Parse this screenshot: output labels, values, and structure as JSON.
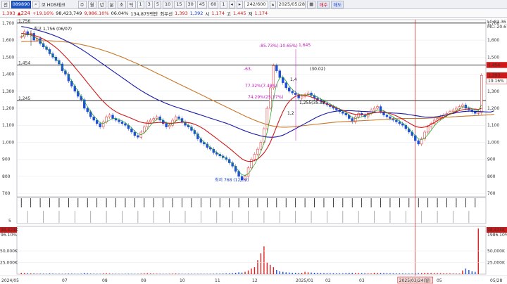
{
  "toolbar": {
    "menu_label": "전",
    "stock_code": "089890",
    "stock_name": "코 HDS테크",
    "periods": [
      "주",
      "월",
      "년",
      "분",
      "초",
      "틱"
    ],
    "intervals": [
      "1",
      "3",
      "5",
      "10",
      "15",
      "30",
      "45",
      "60",
      "1"
    ],
    "count": "242/600",
    "date": "2025/05/28",
    "buttons": [
      "매수",
      "매도"
    ]
  },
  "quote": {
    "price": "1,393",
    "change": "224",
    "change_pct": "+19.16%",
    "volume": "98,423,749",
    "volume_pct": "9,986.10%",
    "turnover_rate": "06.04%",
    "amount": "134,875백만",
    "best_label": "최우선",
    "bid": "1,393",
    "ask": "1,392",
    "open_label": "시",
    "open": "1,174",
    "high_label": "고",
    "high": "1,445",
    "low_label": "저",
    "low": "1,174"
  },
  "colors": {
    "up": "#e02020",
    "down": "#1f4fd8",
    "ma5": "#18a018",
    "ma20": "#d01818",
    "ma60": "#1a1aa8",
    "ma120": "#c87828"
  },
  "price_axis": {
    "ticks": [
      "1,700",
      "1,600",
      "1,500",
      "1,400",
      "1,300",
      "1,200",
      "1,100",
      "1,000",
      "900",
      "800",
      "700"
    ],
    "range": [
      680,
      1720
    ]
  },
  "levels": [
    {
      "label": "1,756",
      "value": 1700,
      "color": "#111"
    },
    {
      "label": "1,454",
      "value": 1454,
      "color": "#111"
    },
    {
      "label": "1,245",
      "value": 1245,
      "color": "#111"
    }
  ],
  "right_flags": [
    {
      "label": "1,454",
      "bg": "#d01818",
      "value": 1454
    },
    {
      "label": "1,393",
      "bg": "#d01818",
      "value": 1393
    },
    {
      "label": "19.16%",
      "bg": "#ffffff",
      "value": 1360
    }
  ],
  "legend_right": {
    "lc": "LC:81.36",
    "mc": "MC:-20.67"
  },
  "annotations": {
    "high_label": "최고 1,756 (06/07)",
    "low_label": "최저 768 (12/09)",
    "pct1": "-85.73%(-10.65%)",
    "peak_value": "1,645",
    "pct2": "-63,",
    "peak_row": "1,4",
    "pct_30": "(30.02)",
    "pct3": "77.32%(7.48%)",
    "pct4": "74.29%(25.37%)",
    "low_tag": "1,255(35.32",
    "mid_label": "1,2"
  },
  "signal_axis": {
    "tick": "5"
  },
  "volume_axis": {
    "ticks": [
      "50,000K",
      "25,000K"
    ],
    "left_top": "98,424K",
    "left_sub": "96.10%",
    "right_top": "98,424K",
    "right_sub": "1986.10%"
  },
  "x_axis": {
    "labels": [
      "2024/05",
      "07",
      "08",
      "09",
      "10",
      "11",
      "12",
      "2025/01",
      "02",
      "03",
      "04",
      "05",
      "05/28"
    ],
    "cursor_label": "2025/03/24(월)"
  },
  "chart_data": {
    "type": "candlestick",
    "ylim": [
      680,
      1720
    ],
    "levels": [
      1700,
      1454,
      1245
    ],
    "closes": [
      1620,
      1650,
      1630,
      1640,
      1600,
      1610,
      1580,
      1560,
      1545,
      1520,
      1500,
      1480,
      1460,
      1420,
      1400,
      1360,
      1330,
      1300,
      1270,
      1250,
      1200,
      1180,
      1150,
      1130,
      1110,
      1090,
      1120,
      1150,
      1160,
      1140,
      1130,
      1120,
      1110,
      1100,
      1080,
      1060,
      1040,
      1030,
      1060,
      1090,
      1120,
      1130,
      1140,
      1150,
      1130,
      1110,
      1090,
      1100,
      1130,
      1150,
      1140,
      1120,
      1100,
      1090,
      1070,
      1050,
      1020,
      1000,
      990,
      970,
      960,
      940,
      930,
      920,
      910,
      900,
      880,
      860,
      830,
      800,
      780,
      800,
      850,
      900,
      930,
      960,
      1000,
      1080,
      1200,
      1320,
      1450,
      1420,
      1380,
      1350,
      1320,
      1300,
      1290,
      1280,
      1260,
      1270,
      1280,
      1290,
      1275,
      1260,
      1250,
      1240,
      1230,
      1220,
      1210,
      1200,
      1190,
      1180,
      1170,
      1160,
      1140,
      1120,
      1150,
      1170,
      1160,
      1150,
      1170,
      1190,
      1200,
      1210,
      1180,
      1160,
      1150,
      1140,
      1130,
      1120,
      1110,
      1100,
      1080,
      1060,
      1040,
      1010,
      990,
      1020,
      1060,
      1090,
      1110,
      1130,
      1140,
      1150,
      1160,
      1170,
      1180,
      1190,
      1200,
      1210,
      1220,
      1200,
      1190,
      1180,
      1170,
      1175,
      1393
    ],
    "ma5": [
      1620,
      1630,
      1635,
      1630,
      1620,
      1610,
      1595,
      1575,
      1555,
      1530,
      1510,
      1490,
      1470,
      1440,
      1420,
      1390,
      1360,
      1330,
      1300,
      1270,
      1240,
      1210,
      1180,
      1155,
      1135,
      1115,
      1110,
      1120,
      1130,
      1140,
      1140,
      1135,
      1125,
      1115,
      1100,
      1085,
      1065,
      1050,
      1045,
      1055,
      1075,
      1100,
      1120,
      1135,
      1140,
      1130,
      1115,
      1105,
      1110,
      1125,
      1135,
      1130,
      1115,
      1100,
      1085,
      1065,
      1045,
      1020,
      1000,
      985,
      970,
      955,
      940,
      928,
      915,
      903,
      890,
      875,
      855,
      830,
      810,
      805,
      815,
      840,
      870,
      905,
      945,
      995,
      1060,
      1150,
      1260,
      1340,
      1380,
      1385,
      1360,
      1330,
      1310,
      1295,
      1282,
      1276,
      1275,
      1280,
      1282,
      1275,
      1265,
      1255,
      1245,
      1235,
      1225,
      1215,
      1205,
      1195,
      1185,
      1175,
      1160,
      1145,
      1140,
      1145,
      1150,
      1155,
      1160,
      1170,
      1180,
      1190,
      1190,
      1185,
      1175,
      1160,
      1148,
      1137,
      1125,
      1113,
      1098,
      1080,
      1060,
      1040,
      1020,
      1015,
      1025,
      1045,
      1070,
      1095,
      1115,
      1130,
      1143,
      1155,
      1165,
      1175,
      1185,
      1195,
      1205,
      1210,
      1205,
      1198,
      1190,
      1183,
      1220
    ],
    "ma20": [
      1640,
      1638,
      1635,
      1632,
      1628,
      1622,
      1615,
      1606,
      1596,
      1584,
      1570,
      1556,
      1540,
      1522,
      1503,
      1483,
      1462,
      1440,
      1418,
      1396,
      1373,
      1350,
      1327,
      1304,
      1282,
      1260,
      1240,
      1222,
      1206,
      1192,
      1180,
      1170,
      1162,
      1155,
      1148,
      1140,
      1132,
      1124,
      1118,
      1114,
      1112,
      1112,
      1114,
      1116,
      1117,
      1116,
      1114,
      1112,
      1112,
      1114,
      1116,
      1118,
      1118,
      1116,
      1112,
      1106,
      1098,
      1088,
      1077,
      1064,
      1050,
      1036,
      1022,
      1008,
      994,
      980,
      965,
      950,
      934,
      918,
      903,
      893,
      888,
      888,
      893,
      903,
      918,
      938,
      965,
      1000,
      1045,
      1092,
      1138,
      1180,
      1215,
      1240,
      1258,
      1270,
      1276,
      1278,
      1276,
      1272,
      1266,
      1258,
      1250,
      1242,
      1234,
      1226,
      1218,
      1210,
      1202,
      1195,
      1188,
      1181,
      1174,
      1168,
      1164,
      1162,
      1162,
      1163,
      1166,
      1170,
      1174,
      1177,
      1178,
      1177,
      1174,
      1169,
      1163,
      1155,
      1146,
      1136,
      1125,
      1114,
      1103,
      1094,
      1089,
      1087,
      1090,
      1096,
      1105,
      1116,
      1127,
      1138,
      1148,
      1158,
      1166,
      1173,
      1180,
      1186,
      1191,
      1194,
      1196,
      1196,
      1195,
      1193,
      1200
    ],
    "ma60": [
      1680,
      1677,
      1673,
      1669,
      1664,
      1659,
      1654,
      1649,
      1643,
      1637,
      1630,
      1623,
      1615,
      1607,
      1598,
      1589,
      1579,
      1569,
      1558,
      1547,
      1535,
      1523,
      1510,
      1497,
      1484,
      1471,
      1458,
      1445,
      1432,
      1419,
      1406,
      1393,
      1380,
      1367,
      1354,
      1341,
      1328,
      1316,
      1304,
      1293,
      1282,
      1272,
      1262,
      1253,
      1244,
      1236,
      1228,
      1221,
      1214,
      1208,
      1202,
      1196,
      1190,
      1184,
      1178,
      1172,
      1166,
      1160,
      1154,
      1148,
      1142,
      1136,
      1130,
      1124,
      1118,
      1112,
      1105,
      1098,
      1090,
      1082,
      1074,
      1067,
      1060,
      1054,
      1048,
      1043,
      1038,
      1034,
      1031,
      1030,
      1030,
      1032,
      1036,
      1042,
      1050,
      1060,
      1070,
      1080,
      1090,
      1100,
      1110,
      1120,
      1130,
      1140,
      1150,
      1158,
      1165,
      1171,
      1176,
      1180,
      1183,
      1185,
      1186,
      1186,
      1186,
      1185,
      1184,
      1183,
      1182,
      1181,
      1180,
      1179,
      1178,
      1177,
      1176,
      1175,
      1174,
      1173,
      1172,
      1171,
      1170,
      1168,
      1166,
      1163,
      1160,
      1157,
      1154,
      1151,
      1149,
      1148,
      1148,
      1149,
      1151,
      1154,
      1158,
      1162,
      1166,
      1170,
      1174,
      1177,
      1180,
      1182,
      1183,
      1183,
      1182,
      1181,
      1180,
      1179,
      1178,
      1178,
      1185
    ],
    "ma120": [
      1590,
      1591,
      1592,
      1593,
      1594,
      1595,
      1596,
      1596,
      1596,
      1596,
      1595,
      1594,
      1593,
      1591,
      1589,
      1587,
      1584,
      1581,
      1578,
      1574,
      1570,
      1566,
      1561,
      1556,
      1551,
      1546,
      1540,
      1534,
      1528,
      1521,
      1514,
      1507,
      1500,
      1492,
      1484,
      1476,
      1468,
      1460,
      1451,
      1442,
      1433,
      1424,
      1415,
      1406,
      1397,
      1388,
      1379,
      1370,
      1361,
      1352,
      1343,
      1334,
      1325,
      1316,
      1307,
      1298,
      1289,
      1280,
      1271,
      1262,
      1253,
      1244,
      1235,
      1226,
      1217,
      1208,
      1199,
      1190,
      1181,
      1172,
      1163,
      1154,
      1146,
      1138,
      1130,
      1123,
      1116,
      1110,
      1104,
      1099,
      1095,
      1092,
      1090,
      1089,
      1089,
      1090,
      1091,
      1093,
      1095,
      1097,
      1099,
      1101,
      1103,
      1105,
      1107,
      1109,
      1111,
      1113,
      1115,
      1117,
      1119,
      1120,
      1121,
      1122,
      1123,
      1124,
      1125,
      1126,
      1127,
      1128,
      1129,
      1130,
      1131,
      1132,
      1133,
      1134,
      1135,
      1136,
      1137,
      1138,
      1139,
      1140,
      1140,
      1140,
      1140,
      1140,
      1140,
      1140,
      1141,
      1142,
      1143,
      1144,
      1145,
      1146,
      1147,
      1148,
      1149,
      1150,
      1151,
      1152,
      1153,
      1154,
      1155,
      1156,
      1157,
      1158,
      1159,
      1160,
      1161,
      1162,
      1165
    ],
    "volume_k": [
      3000,
      2500,
      2000,
      1800,
      1500,
      1300,
      1200,
      1100,
      1000,
      1500,
      1200,
      900,
      1000,
      800,
      1100,
      1300,
      1200,
      900,
      800,
      1000,
      2500,
      1800,
      1200,
      1000,
      900,
      800,
      1600,
      2000,
      1300,
      1000,
      900,
      800,
      700,
      900,
      1000,
      800,
      700,
      800,
      1200,
      1800,
      2000,
      1500,
      1200,
      1000,
      900,
      800,
      700,
      900,
      1200,
      1400,
      1000,
      800,
      700,
      900,
      800,
      700,
      800,
      900,
      800,
      700,
      800,
      900,
      1000,
      1200,
      1400,
      1600,
      1800,
      2200,
      3000,
      4000,
      3500,
      5000,
      8000,
      12000,
      15000,
      30000,
      45000,
      60000,
      25000,
      20000,
      15000,
      9000,
      6000,
      5000,
      4000,
      3500,
      3000,
      2800,
      2500,
      3000,
      5000,
      4000,
      3500,
      3000,
      2800,
      2500,
      2300,
      2200,
      2000,
      1900,
      1800,
      1700,
      1600,
      2500,
      3000,
      2800,
      2600,
      2400,
      2200,
      2000,
      1800,
      1600,
      3000,
      2800,
      2600,
      2400,
      2200,
      2000,
      1800,
      1700,
      1600,
      1500,
      1400,
      1300,
      1200,
      1500,
      2000,
      2500,
      3000,
      2800,
      2600,
      2400,
      2200,
      2000,
      1800,
      1600,
      1500,
      1400,
      1300,
      1200,
      8000,
      12000,
      9000,
      6000,
      5000,
      98424
    ]
  }
}
